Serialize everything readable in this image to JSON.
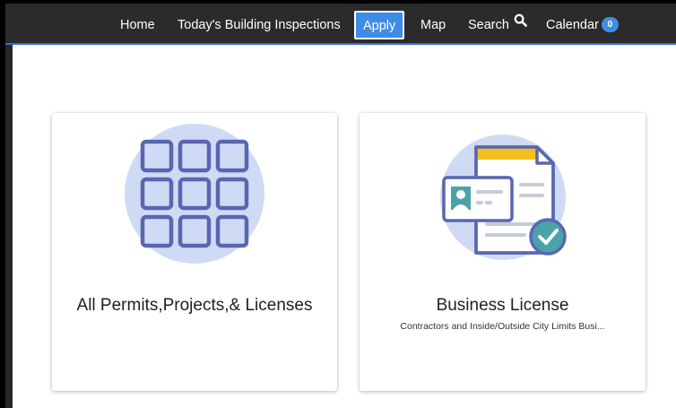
{
  "nav": {
    "home": "Home",
    "inspections": "Today's Building Inspections",
    "apply": "Apply",
    "map": "Map",
    "search": "Search",
    "calendar": "Calendar",
    "calendar_count": "0",
    "search_icon": "search-icon"
  },
  "cards": [
    {
      "title": "All Permits,Projects,& Licenses",
      "subtitle": "",
      "icon": "grid-icon"
    },
    {
      "title": "Business License",
      "subtitle": "Contractors and Inside/Outside City Limits Busi...",
      "icon": "business-license-icon"
    }
  ],
  "colors": {
    "navbar": "#2b2b2b",
    "accent": "#3d8ce6",
    "illustration_circle": "#cfdbf5",
    "illustration_stroke": "#5a66b0",
    "check_green": "#4aa3a8",
    "yellow": "#f4c020"
  }
}
